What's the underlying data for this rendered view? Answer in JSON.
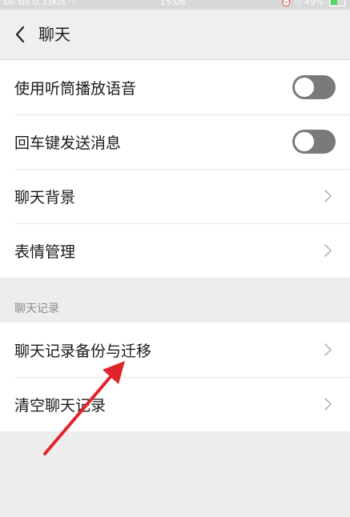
{
  "status_bar": {
    "left": "sill sill 0.33K/s ···",
    "time": "15:06",
    "right": "⏰ ⏱ 49%"
  },
  "header": {
    "title": "聊天"
  },
  "group1": {
    "items": [
      {
        "label": "使用听筒播放语音",
        "control": "toggle",
        "on": false
      },
      {
        "label": "回车键发送消息",
        "control": "toggle",
        "on": false
      },
      {
        "label": "聊天背景",
        "control": "chevron"
      },
      {
        "label": "表情管理",
        "control": "chevron"
      }
    ]
  },
  "section_header": "聊天记录",
  "group2": {
    "items": [
      {
        "label": "聊天记录备份与迁移",
        "control": "chevron"
      },
      {
        "label": "清空聊天记录",
        "control": "chevron"
      }
    ]
  },
  "colors": {
    "annotation_arrow": "#e0242b",
    "toggle_off": "#7a7a7a"
  }
}
